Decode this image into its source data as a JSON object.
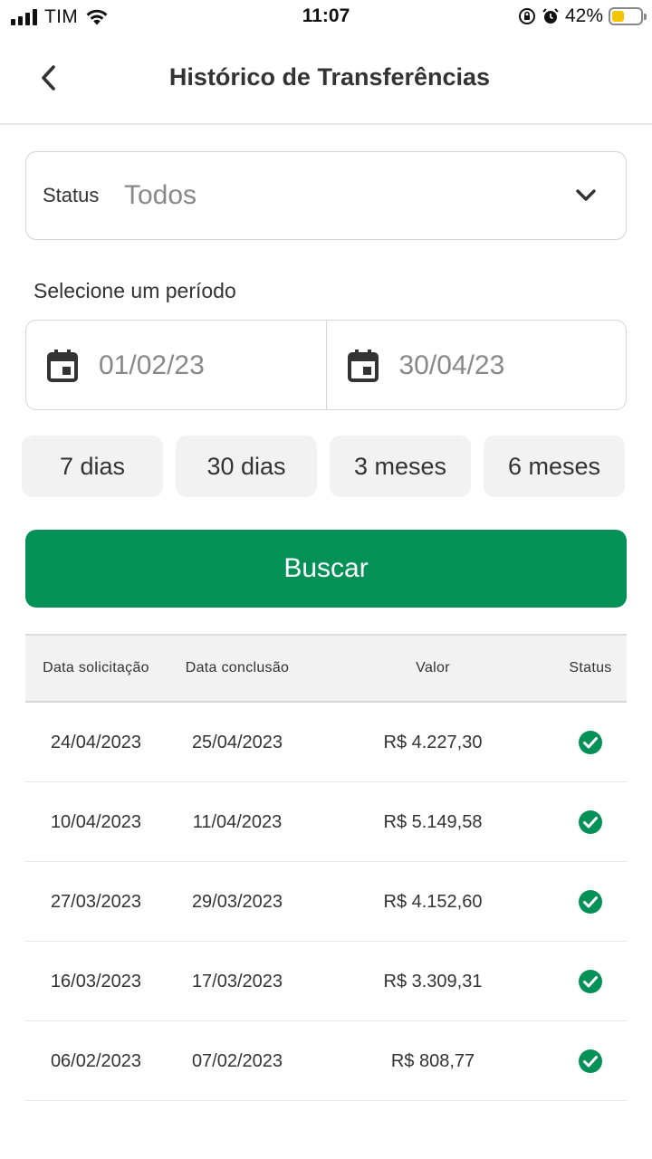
{
  "status_bar": {
    "carrier": "TIM",
    "time": "11:07",
    "battery_percent": "42%",
    "battery_level": 0.42
  },
  "header": {
    "title": "Histórico de Transferências",
    "back_icon": "chevron-left-icon"
  },
  "status_filter": {
    "label": "Status",
    "value": "Todos",
    "icon": "chevron-down-icon"
  },
  "period": {
    "label": "Selecione um período",
    "start_date": "01/02/23",
    "end_date": "30/04/23",
    "icon": "calendar-icon"
  },
  "quick_ranges": [
    "7 dias",
    "30 dias",
    "3 meses",
    "6 meses"
  ],
  "search_button": "Buscar",
  "colors": {
    "accent": "#039157",
    "text": "#333333",
    "muted": "#888888",
    "chip_bg": "#f2f2f2"
  },
  "table": {
    "headers": [
      "Data solicitação",
      "Data conclusão",
      "Valor",
      "Status"
    ],
    "rows": [
      {
        "requested": "24/04/2023",
        "completed": "25/04/2023",
        "amount": "R$ 4.227,30",
        "status": "check-circle-icon"
      },
      {
        "requested": "10/04/2023",
        "completed": "11/04/2023",
        "amount": "R$ 5.149,58",
        "status": "check-circle-icon"
      },
      {
        "requested": "27/03/2023",
        "completed": "29/03/2023",
        "amount": "R$ 4.152,60",
        "status": "check-circle-icon"
      },
      {
        "requested": "16/03/2023",
        "completed": "17/03/2023",
        "amount": "R$ 3.309,31",
        "status": "check-circle-icon"
      },
      {
        "requested": "06/02/2023",
        "completed": "07/02/2023",
        "amount": "R$ 808,77",
        "status": "check-circle-icon"
      }
    ]
  }
}
